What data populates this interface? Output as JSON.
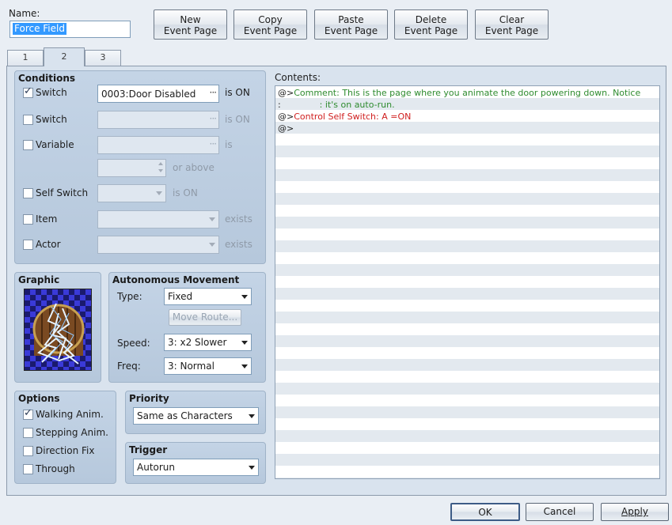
{
  "name_label": "Name:",
  "name_value": "Force Field",
  "top_buttons": [
    {
      "line1": "New",
      "line2": "Event Page"
    },
    {
      "line1": "Copy",
      "line2": "Event Page"
    },
    {
      "line1": "Paste",
      "line2": "Event Page"
    },
    {
      "line1": "Delete",
      "line2": "Event Page"
    },
    {
      "line1": "Clear",
      "line2": "Event Page"
    }
  ],
  "tabs": [
    "1",
    "2",
    "3"
  ],
  "active_tab": "2",
  "conditions": {
    "title": "Conditions",
    "switch1": {
      "label": "Switch",
      "checked": true,
      "value": "0003:Door Disabled",
      "suffix": "is ON"
    },
    "switch2": {
      "label": "Switch",
      "checked": false,
      "value": "",
      "suffix": "is ON"
    },
    "variable": {
      "label": "Variable",
      "checked": false,
      "value": "",
      "suffix": "is",
      "number": "",
      "number_suffix": "or above"
    },
    "self_switch": {
      "label": "Self Switch",
      "checked": false,
      "value": "",
      "suffix": "is ON"
    },
    "item": {
      "label": "Item",
      "checked": false,
      "value": "",
      "suffix": "exists"
    },
    "actor": {
      "label": "Actor",
      "checked": false,
      "value": "",
      "suffix": "exists"
    }
  },
  "graphic": {
    "title": "Graphic",
    "icon": "door-force-field-sprite"
  },
  "movement": {
    "title": "Autonomous Movement",
    "type_label": "Type:",
    "type_value": "Fixed",
    "move_route_label": "Move Route...",
    "speed_label": "Speed:",
    "speed_value": "3: x2 Slower",
    "freq_label": "Freq:",
    "freq_value": "3: Normal"
  },
  "options": {
    "title": "Options",
    "items": [
      {
        "label": "Walking Anim.",
        "checked": true
      },
      {
        "label": "Stepping Anim.",
        "checked": false
      },
      {
        "label": "Direction Fix",
        "checked": false
      },
      {
        "label": "Through",
        "checked": false
      }
    ]
  },
  "priority": {
    "title": "Priority",
    "value": "Same as Characters"
  },
  "trigger": {
    "title": "Trigger",
    "value": "Autorun"
  },
  "contents": {
    "label": "Contents:",
    "lines": [
      {
        "prefix": "@>",
        "text": "Comment: This is the page where you animate the door powering down. Notice",
        "color": "#2e8b2e"
      },
      {
        "prefix": " :",
        "text": "              : it's on auto-run.",
        "color": "#2e8b2e"
      },
      {
        "prefix": "@>",
        "text": "Control Self Switch: A =ON",
        "color": "#d02020"
      },
      {
        "prefix": "@>",
        "text": "",
        "color": "#1d1d1d"
      }
    ]
  },
  "bottom_buttons": {
    "ok": "OK",
    "cancel": "Cancel",
    "apply": "Apply"
  }
}
